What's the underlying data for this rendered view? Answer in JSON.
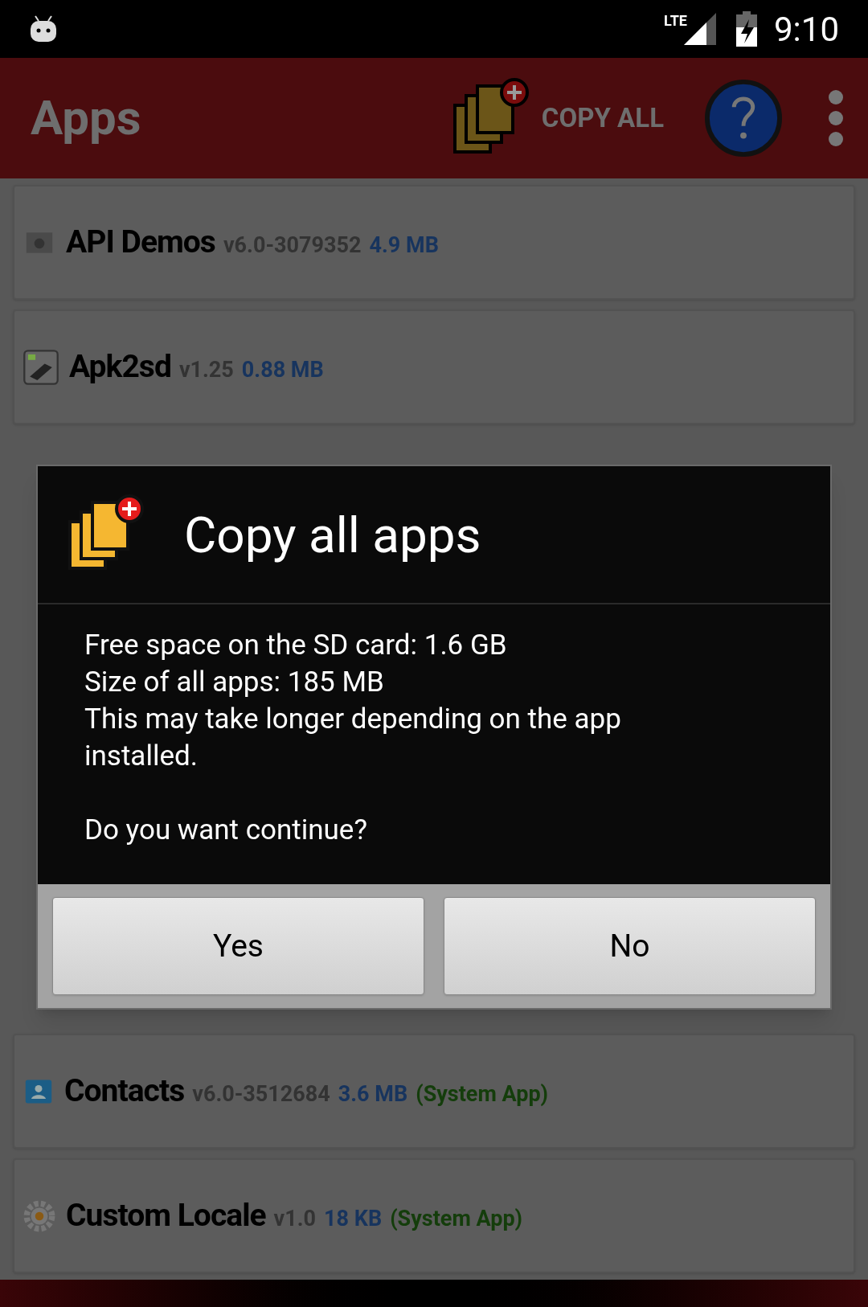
{
  "status_bar": {
    "time": "9:10",
    "network": "LTE"
  },
  "app_bar": {
    "title": "Apps",
    "copy_all": "COPY ALL"
  },
  "rows_above": [
    {
      "name": "API Demos",
      "version": "v6.0-3079352",
      "size": "4.9 MB"
    },
    {
      "name": "Apk2sd",
      "version": "v1.25",
      "size": "0.88 MB"
    }
  ],
  "dialog": {
    "title": "Copy all apps",
    "lines": [
      "Free space on the SD card: 1.6 GB",
      "Size of all apps: 185 MB",
      "This may take longer depending on the app installed."
    ],
    "question": "Do you want continue?",
    "buttons": [
      "Yes",
      "No"
    ]
  },
  "rows_below": [
    {
      "name": "Contacts",
      "version": "v6.0-3512684",
      "size": "3.6 MB",
      "system": "(System App)"
    },
    {
      "name": "Custom Locale",
      "version": "v1.0",
      "size": "18 KB",
      "system": "(System App)"
    }
  ]
}
